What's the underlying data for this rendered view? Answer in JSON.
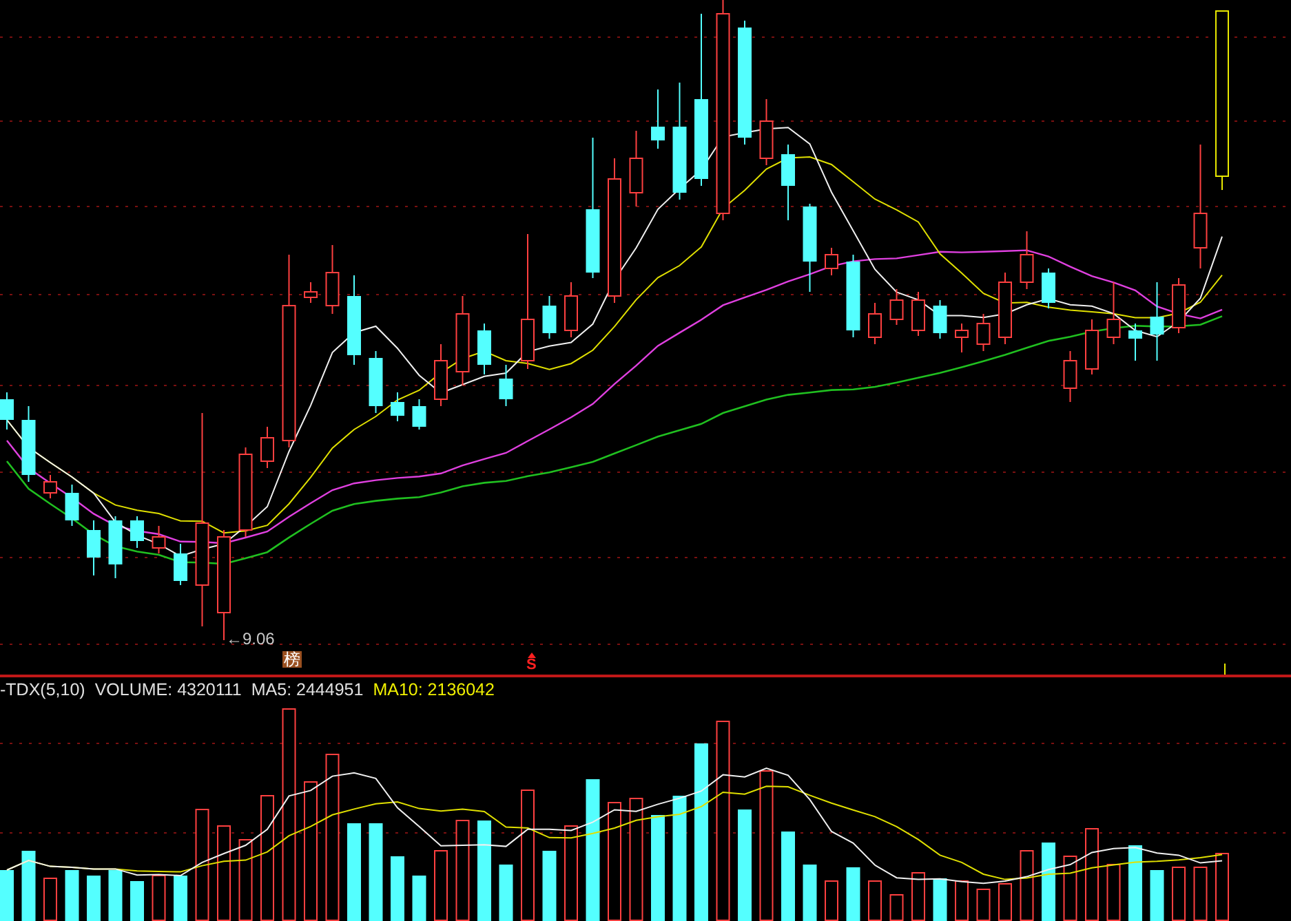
{
  "price_chart": {
    "low_label": "←9.06",
    "list_badge": "榜",
    "signal_mark": "S"
  },
  "indicator_bar": {
    "items": [
      {
        "text": "-TDX(5,10)",
        "color": "#e0e0e0"
      },
      {
        "text": "VOLUME: 4320111",
        "color": "#e0e0e0"
      },
      {
        "text": "MA5: 2444951",
        "color": "#e0e0e0"
      },
      {
        "text": "MA10: 2136042",
        "color": "#f0f000"
      }
    ]
  }
}
